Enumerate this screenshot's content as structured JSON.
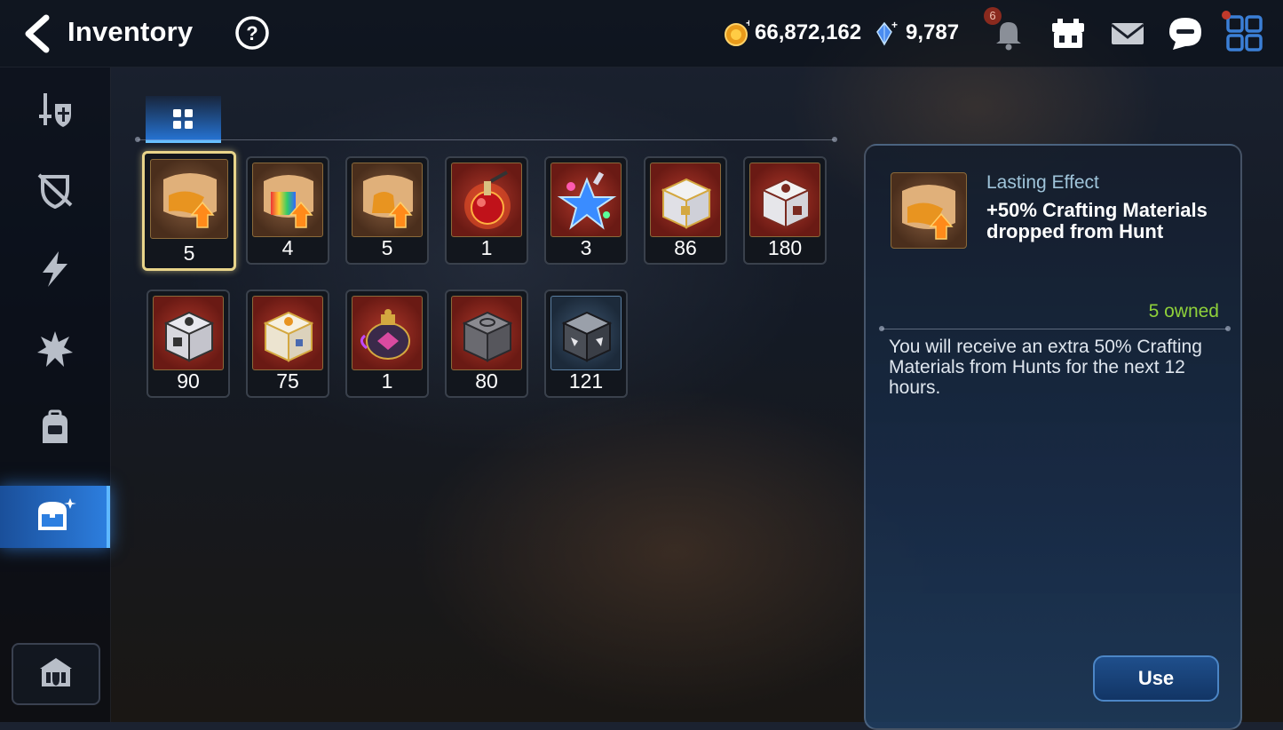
{
  "header": {
    "title": "Inventory",
    "gold": "66,872,162",
    "crystals": "9,787",
    "notification_count": "6"
  },
  "sidebar": {
    "items": [
      {
        "icon": "sword-shield-icon"
      },
      {
        "icon": "crossed-shield-icon"
      },
      {
        "icon": "lightning-icon"
      },
      {
        "icon": "explosion-icon"
      },
      {
        "icon": "backpack-icon"
      },
      {
        "icon": "treasure-chest-icon",
        "active": true
      }
    ],
    "bottom_icon": "guild-house-icon"
  },
  "inventory": {
    "items": [
      {
        "name": "scroll-gold",
        "count": "5",
        "selected": true
      },
      {
        "name": "scroll-rainbow",
        "count": "4"
      },
      {
        "name": "scroll-bag",
        "count": "5"
      },
      {
        "name": "red-potion",
        "count": "1"
      },
      {
        "name": "blue-star-potion",
        "count": "3"
      },
      {
        "name": "white-gold-chest",
        "count": "86"
      },
      {
        "name": "white-red-chest",
        "count": "180"
      },
      {
        "name": "silver-chest",
        "count": "90"
      },
      {
        "name": "gold-white-chest",
        "count": "75"
      },
      {
        "name": "purple-urn",
        "count": "1"
      },
      {
        "name": "stone-chest",
        "count": "80"
      },
      {
        "name": "dark-silver-chest",
        "count": "121"
      }
    ]
  },
  "detail": {
    "category": "Lasting Effect",
    "name": "+50% Crafting Materials dropped from Hunt",
    "owned": "5 owned",
    "description": "You will receive an extra 50% Crafting Materials from Hunts for the next 12 hours.",
    "use_label": "Use"
  },
  "colors": {
    "accent_blue": "#2d7fe0",
    "owned_green": "#8fd13a",
    "selected_gold": "#e8d48a"
  }
}
